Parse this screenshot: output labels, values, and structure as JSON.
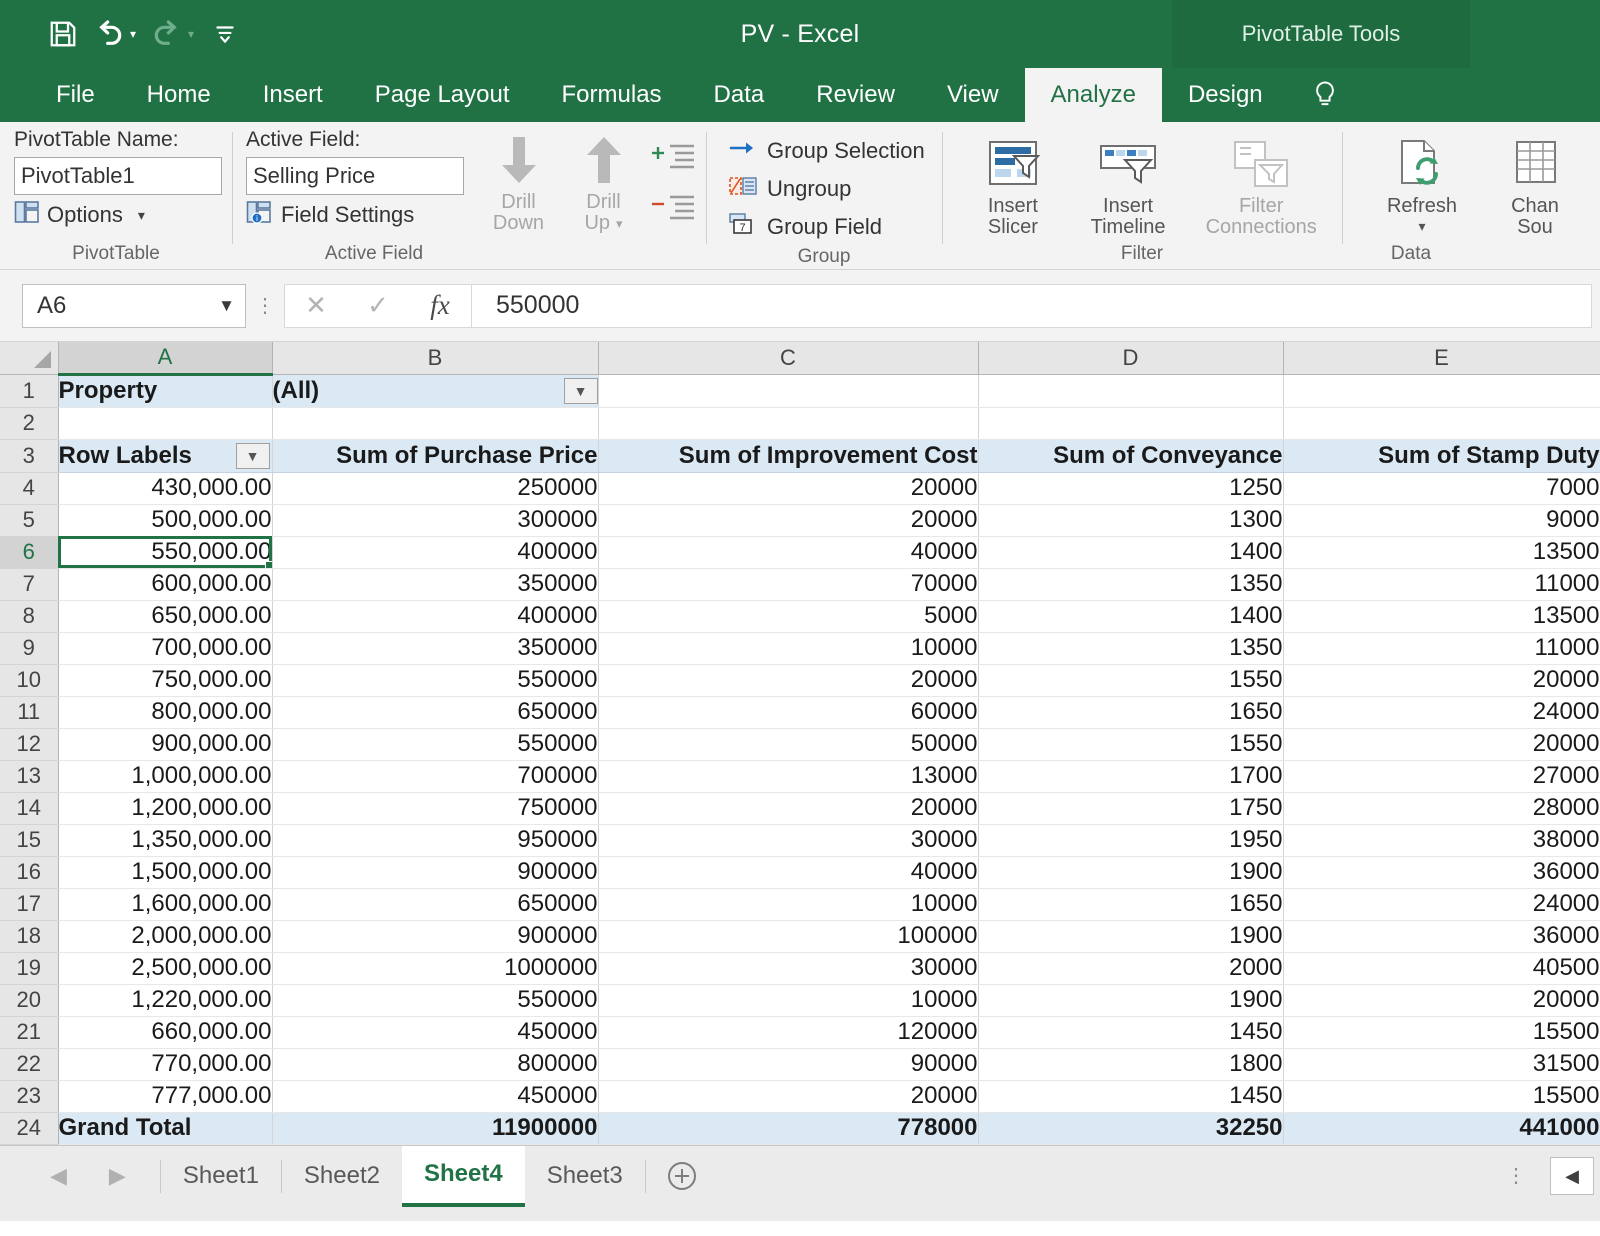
{
  "titlebar": {
    "quick_access": [
      {
        "name": "save-icon",
        "label": "Save"
      },
      {
        "name": "undo-icon",
        "label": "Undo"
      },
      {
        "name": "redo-icon",
        "label": "Redo"
      },
      {
        "name": "customize-qat-icon",
        "label": "Customize Quick Access Toolbar"
      }
    ],
    "title": "PV - Excel",
    "context_tools": "PivotTable Tools"
  },
  "tabs": [
    {
      "label": "File",
      "active": false
    },
    {
      "label": "Home",
      "active": false
    },
    {
      "label": "Insert",
      "active": false
    },
    {
      "label": "Page Layout",
      "active": false
    },
    {
      "label": "Formulas",
      "active": false
    },
    {
      "label": "Data",
      "active": false
    },
    {
      "label": "Review",
      "active": false
    },
    {
      "label": "View",
      "active": false
    },
    {
      "label": "Analyze",
      "active": true
    },
    {
      "label": "Design",
      "active": false
    }
  ],
  "tell_me_icon": "lightbulb-icon",
  "ribbon": {
    "pivottable_group": {
      "name_label": "PivotTable Name:",
      "name_value": "PivotTable1",
      "options_label": "Options",
      "group_label": "PivotTable"
    },
    "active_field_group": {
      "field_label": "Active Field:",
      "field_value": "Selling Price",
      "field_settings_label": "Field Settings",
      "drill_down_label": "Drill\nDown",
      "drill_down_line1": "Drill",
      "drill_down_line2": "Down",
      "drill_up_line1": "Drill",
      "drill_up_line2": "Up",
      "expand_field_label": "Expand Field",
      "collapse_field_label": "Collapse Field",
      "group_label": "Active Field"
    },
    "group_group": {
      "group_selection": "Group Selection",
      "ungroup": "Ungroup",
      "group_field": "Group Field",
      "group_label": "Group"
    },
    "filter_group": {
      "insert_slicer_line1": "Insert",
      "insert_slicer_line2": "Slicer",
      "insert_timeline_line1": "Insert",
      "insert_timeline_line2": "Timeline",
      "filter_connections_line1": "Filter",
      "filter_connections_line2": "Connections",
      "group_label": "Filter"
    },
    "data_group": {
      "refresh_label": "Refresh",
      "change_source_line1": "Chan",
      "change_source_line2": "Sou",
      "group_label": "Data"
    }
  },
  "formula_bar": {
    "name_box": "A6",
    "cancel_icon": "close-icon",
    "enter_icon": "check-icon",
    "function_icon": "fx",
    "formula_value": "550000"
  },
  "grid": {
    "column_letters": [
      "A",
      "B",
      "C",
      "D",
      "E"
    ],
    "selected_column": "A",
    "selected_row": 6,
    "row_numbers": [
      1,
      2,
      3,
      4,
      5,
      6,
      7,
      8,
      9,
      10,
      11,
      12,
      13,
      14,
      15,
      16,
      17,
      18,
      19,
      20,
      21,
      22,
      23,
      24
    ],
    "filter_row": {
      "field": "Property",
      "value": "(All)"
    },
    "headers": [
      "Row Labels",
      "Sum of Purchase Price",
      "Sum of Improvement Cost",
      "Sum of Conveyance",
      "Sum of Stamp Duty"
    ],
    "rows": [
      {
        "row": 4,
        "label": "430,000.00",
        "purchase": "250000",
        "improvement": "20000",
        "conveyance": "1250",
        "stamp": "7000"
      },
      {
        "row": 5,
        "label": "500,000.00",
        "purchase": "300000",
        "improvement": "20000",
        "conveyance": "1300",
        "stamp": "9000"
      },
      {
        "row": 6,
        "label": "550,000.00",
        "purchase": "400000",
        "improvement": "40000",
        "conveyance": "1400",
        "stamp": "13500"
      },
      {
        "row": 7,
        "label": "600,000.00",
        "purchase": "350000",
        "improvement": "70000",
        "conveyance": "1350",
        "stamp": "11000"
      },
      {
        "row": 8,
        "label": "650,000.00",
        "purchase": "400000",
        "improvement": "5000",
        "conveyance": "1400",
        "stamp": "13500"
      },
      {
        "row": 9,
        "label": "700,000.00",
        "purchase": "350000",
        "improvement": "10000",
        "conveyance": "1350",
        "stamp": "11000"
      },
      {
        "row": 10,
        "label": "750,000.00",
        "purchase": "550000",
        "improvement": "20000",
        "conveyance": "1550",
        "stamp": "20000"
      },
      {
        "row": 11,
        "label": "800,000.00",
        "purchase": "650000",
        "improvement": "60000",
        "conveyance": "1650",
        "stamp": "24000"
      },
      {
        "row": 12,
        "label": "900,000.00",
        "purchase": "550000",
        "improvement": "50000",
        "conveyance": "1550",
        "stamp": "20000"
      },
      {
        "row": 13,
        "label": "1,000,000.00",
        "purchase": "700000",
        "improvement": "13000",
        "conveyance": "1700",
        "stamp": "27000"
      },
      {
        "row": 14,
        "label": "1,200,000.00",
        "purchase": "750000",
        "improvement": "20000",
        "conveyance": "1750",
        "stamp": "28000"
      },
      {
        "row": 15,
        "label": "1,350,000.00",
        "purchase": "950000",
        "improvement": "30000",
        "conveyance": "1950",
        "stamp": "38000"
      },
      {
        "row": 16,
        "label": "1,500,000.00",
        "purchase": "900000",
        "improvement": "40000",
        "conveyance": "1900",
        "stamp": "36000"
      },
      {
        "row": 17,
        "label": "1,600,000.00",
        "purchase": "650000",
        "improvement": "10000",
        "conveyance": "1650",
        "stamp": "24000"
      },
      {
        "row": 18,
        "label": "2,000,000.00",
        "purchase": "900000",
        "improvement": "100000",
        "conveyance": "1900",
        "stamp": "36000"
      },
      {
        "row": 19,
        "label": "2,500,000.00",
        "purchase": "1000000",
        "improvement": "30000",
        "conveyance": "2000",
        "stamp": "40500"
      },
      {
        "row": 20,
        "label": "1,220,000.00",
        "purchase": "550000",
        "improvement": "10000",
        "conveyance": "1900",
        "stamp": "20000"
      },
      {
        "row": 21,
        "label": "660,000.00",
        "purchase": "450000",
        "improvement": "120000",
        "conveyance": "1450",
        "stamp": "15500"
      },
      {
        "row": 22,
        "label": "770,000.00",
        "purchase": "800000",
        "improvement": "90000",
        "conveyance": "1800",
        "stamp": "31500"
      },
      {
        "row": 23,
        "label": "777,000.00",
        "purchase": "450000",
        "improvement": "20000",
        "conveyance": "1450",
        "stamp": "15500"
      }
    ],
    "grand_total": {
      "row": 24,
      "label": "Grand Total",
      "purchase": "11900000",
      "improvement": "778000",
      "conveyance": "32250",
      "stamp": "441000"
    }
  },
  "sheetbar": {
    "sheets": [
      {
        "label": "Sheet1",
        "active": false
      },
      {
        "label": "Sheet2",
        "active": false
      },
      {
        "label": "Sheet4",
        "active": true
      },
      {
        "label": "Sheet3",
        "active": false
      }
    ],
    "add_sheet_icon": "plus-circle-icon",
    "prev_icon": "chevron-left-icon",
    "next_icon": "chevron-right-icon",
    "scroll_left_icon": "triangle-left-icon"
  },
  "colors": {
    "excel_green": "#207245",
    "accent_green": "#217346",
    "pivot_header_blue": "#dbe9f5"
  }
}
